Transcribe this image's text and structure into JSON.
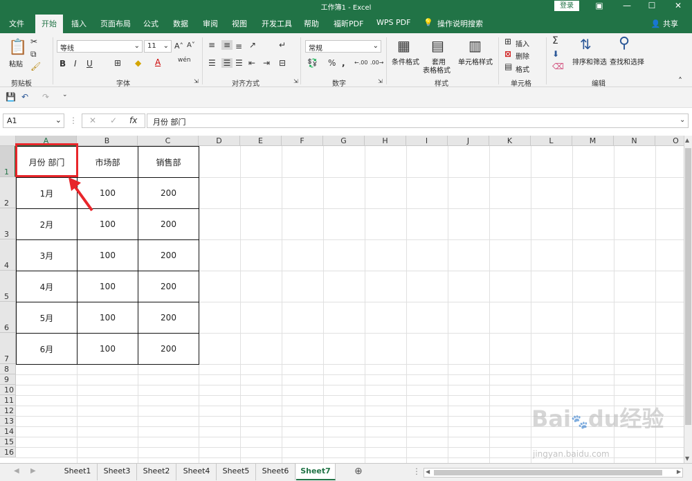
{
  "window": {
    "title": "工作簿1  -  Excel",
    "login": "登录"
  },
  "tabs": [
    "文件",
    "开始",
    "插入",
    "页面布局",
    "公式",
    "数据",
    "审阅",
    "视图",
    "开发工具",
    "帮助",
    "福昕PDF",
    "WPS PDF"
  ],
  "tell_me": "操作说明搜索",
  "share": "共享",
  "ribbon": {
    "clipboard": {
      "paste": "粘贴",
      "label": "剪贴板"
    },
    "font": {
      "name": "等线",
      "size": "11",
      "label": "字体",
      "bold": "B",
      "italic": "I",
      "underline": "U",
      "grow": "A",
      "shrink": "A",
      "fill_letter": "A",
      "phonetic": "wén"
    },
    "align": {
      "label": "对齐方式"
    },
    "number": {
      "format": "常规",
      "label": "数字"
    },
    "styles": {
      "conditional": "条件格式",
      "table1": "套用",
      "table2": "表格格式",
      "cell": "单元格样式",
      "label": "样式"
    },
    "cells": {
      "insert": "插入",
      "delete": "删除",
      "format": "格式",
      "label": "单元格"
    },
    "edit": {
      "sort": "排序和筛选",
      "find": "查找和选择",
      "label": "编辑"
    }
  },
  "formula_bar": {
    "cell_ref": "A1",
    "fx": "fx",
    "content": "月份  部门"
  },
  "columns": [
    "A",
    "B",
    "C",
    "D",
    "E",
    "F",
    "G",
    "H",
    "I",
    "J",
    "K",
    "L",
    "M",
    "N",
    "O"
  ],
  "rows": [
    "1",
    "2",
    "3",
    "4",
    "5",
    "6",
    "7",
    "8",
    "9",
    "10",
    "11",
    "12",
    "13",
    "14",
    "15",
    "16"
  ],
  "table": {
    "header": [
      "月份  部门",
      "市场部",
      "销售部"
    ],
    "body": [
      [
        "1月",
        "100",
        "200"
      ],
      [
        "2月",
        "100",
        "200"
      ],
      [
        "3月",
        "100",
        "200"
      ],
      [
        "4月",
        "100",
        "200"
      ],
      [
        "5月",
        "100",
        "200"
      ],
      [
        "6月",
        "100",
        "200"
      ]
    ]
  },
  "sheets": [
    "Sheet1",
    "Sheet3",
    "Sheet2",
    "Sheet4",
    "Sheet5",
    "Sheet6",
    "Sheet7"
  ],
  "active_sheet": "Sheet7",
  "watermark": {
    "brand": "Bai",
    "brand2": "du",
    "suffix": "经验",
    "url": "jingyan.baidu.com"
  },
  "colors": {
    "accent": "#217346",
    "highlight": "#e8262b"
  }
}
